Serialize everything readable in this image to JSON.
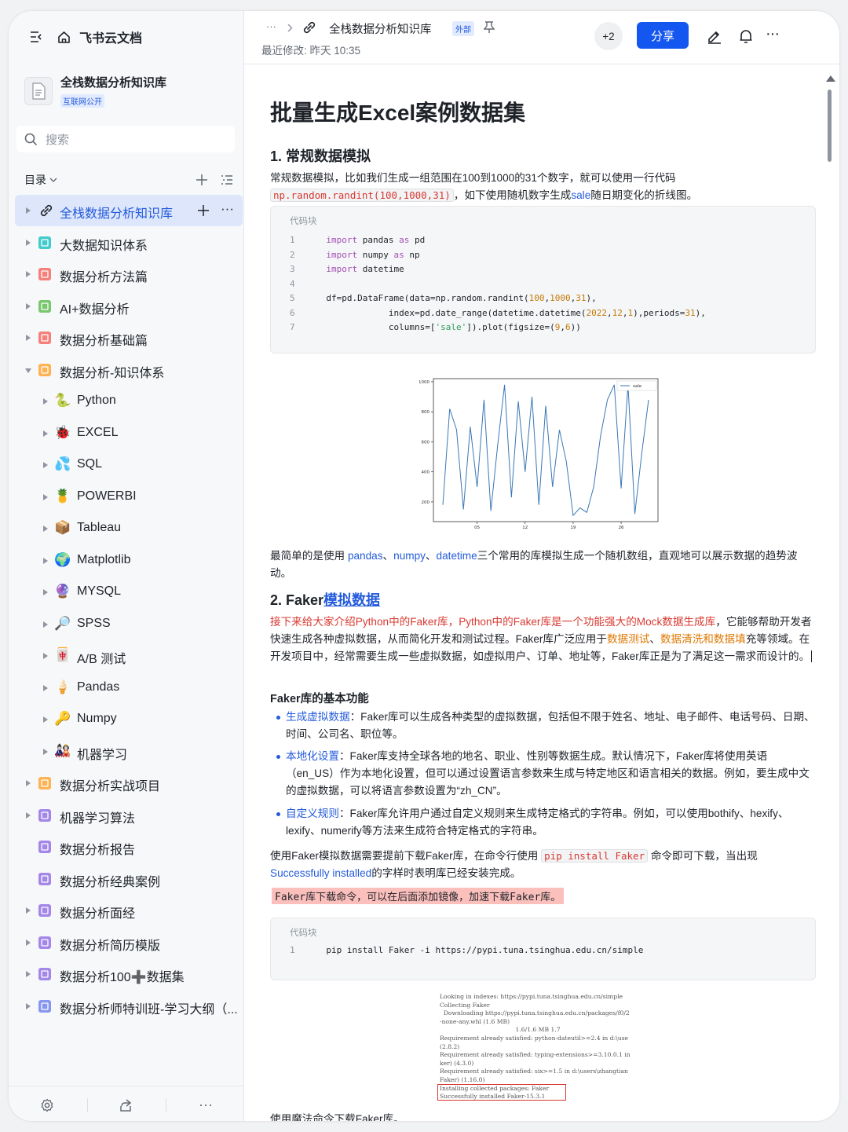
{
  "app": {
    "title": "飞书云文档"
  },
  "space": {
    "name": "全栈数据分析知识库",
    "badge": "互联网公开"
  },
  "search": {
    "placeholder": "搜索"
  },
  "toc": {
    "label": "目录"
  },
  "tree": [
    {
      "label": "全栈数据分析知识库",
      "level": 0,
      "active": true,
      "expand": "right",
      "color": "#245bdb"
    },
    {
      "label": "大数据知识体系",
      "level": 0,
      "expand": "right",
      "color": "#2ec7c9"
    },
    {
      "label": "数据分析方法篇",
      "level": 0,
      "expand": "right",
      "color": "#f5746d"
    },
    {
      "label": "AI+数据分析",
      "level": 0,
      "expand": "right",
      "color": "#6cc25e"
    },
    {
      "label": "数据分析基础篇",
      "level": 0,
      "expand": "right",
      "color": "#f5746d"
    },
    {
      "label": "数据分析-知识体系",
      "level": 0,
      "expand": "down",
      "color": "#ffab40"
    },
    {
      "label": "Python",
      "level": 1,
      "expand": "right",
      "emoji": "🐍"
    },
    {
      "label": "EXCEL",
      "level": 1,
      "expand": "right",
      "emoji": "🐞"
    },
    {
      "label": "SQL",
      "level": 1,
      "expand": "right",
      "emoji": "💦"
    },
    {
      "label": "POWERBI",
      "level": 1,
      "expand": "right",
      "emoji": "🍍"
    },
    {
      "label": "Tableau",
      "level": 1,
      "expand": "right",
      "emoji": "📦"
    },
    {
      "label": "Matplotlib",
      "level": 1,
      "expand": "right",
      "emoji": "🌍"
    },
    {
      "label": "MYSQL",
      "level": 1,
      "expand": "right",
      "emoji": "🔮"
    },
    {
      "label": "SPSS",
      "level": 1,
      "expand": "right",
      "emoji": "🔎"
    },
    {
      "label": "A/B 测试",
      "level": 1,
      "expand": "right",
      "emoji": "🀄"
    },
    {
      "label": "Pandas",
      "level": 1,
      "expand": "right",
      "emoji": "🍦"
    },
    {
      "label": "Numpy",
      "level": 1,
      "expand": "right",
      "emoji": "🔑"
    },
    {
      "label": "机器学习",
      "level": 1,
      "expand": "right",
      "emoji": "🎎"
    },
    {
      "label": "数据分析实战项目",
      "level": 0,
      "expand": "right",
      "color": "#ffab40"
    },
    {
      "label": "机器学习算法",
      "level": 0,
      "expand": "right",
      "color": "#9b7be8"
    },
    {
      "label": "数据分析报告",
      "level": 0,
      "expand": "none",
      "color": "#9b7be8"
    },
    {
      "label": "数据分析经典案例",
      "level": 0,
      "expand": "none",
      "color": "#9b7be8"
    },
    {
      "label": "数据分析面经",
      "level": 0,
      "expand": "right",
      "color": "#9b7be8"
    },
    {
      "label": "数据分析简历模版",
      "level": 0,
      "expand": "right",
      "color": "#9b7be8"
    },
    {
      "label": "数据分析100➕数据集",
      "level": 0,
      "expand": "right",
      "color": "#9b7be8"
    },
    {
      "label": "数据分析师特训班-学习大纲（...",
      "level": 0,
      "expand": "right",
      "color": "#7b8cf0"
    }
  ],
  "topbar": {
    "ellipsis": "···",
    "breadcrumb": "全栈数据分析知识库",
    "external": "外部",
    "modified": "最近修改: 昨天 10:35",
    "collab": "+2",
    "share": "分享"
  },
  "doc": {
    "title": "批量生成Excel案例数据集",
    "h1": "1. 常规数据模拟",
    "p1a": "常规数据模拟，比如我们生成一组范围在100到1000的31个数字，就可以使用一行代码",
    "p1code": "np.random.randint(100,1000,31)",
    "p1b": "，如下使用随机数字生成",
    "p1link": "sale",
    "p1c": "随日期变化的折线图。",
    "code_label": "代码块",
    "code1": [
      "import pandas as pd",
      "import numpy as np",
      "import datetime",
      "",
      "df=pd.DataFrame(data=np.random.randint(100,1000,31),",
      "            index=pd.date_range(datetime.datetime(2022,12,1),periods=31),",
      "            columns=['sale']).plot(figsize=(9,6))"
    ],
    "p2a": "最简单的是使用 ",
    "p2l1": "pandas",
    "p2sep": "、",
    "p2l2": "numpy",
    "p2l3": "datetime",
    "p2b": "三个常用的库模拟生成一个随机数组，直观地可以展示数据的趋势波动。",
    "h2a": "2. Faker",
    "h2b": "模拟数据",
    "p3red": "接下来给大家介绍Python中的Faker库，Python中的Faker库是一个功能强大的Mock数据生成库",
    "p3a": "，它能够帮助开发者快速生成各种虚拟数据，从而简化开发和测试过程。Faker库广泛应用于",
    "p3o1": "数据测试",
    "p3o2": "数据清洗和数据填",
    "p3b": "充等领域。在开发项目中，经常需要生成一些虚拟数据，如虚拟用户、订单、地址等，Faker库正是为了满足这一需求而设计的。",
    "h3": "Faker库的基本功能",
    "bullets": [
      {
        "link": "生成虚拟数据",
        "text": "：Faker库可以生成各种类型的虚拟数据，包括但不限于姓名、地址、电子邮件、电话号码、日期、时间、公司名、职位等。"
      },
      {
        "link": "本地化设置",
        "text": "：Faker库支持全球各地的地名、职业、性别等数据生成。默认情况下，Faker库将使用英语（en_US）作为本地化设置，但可以通过设置语言参数来生成与特定地区和语言相关的数据。例如，要生成中文的虚拟数据，可以将语言参数设置为“zh_CN”。"
      },
      {
        "link": "自定义规则",
        "text": "：Faker库允许用户通过自定义规则来生成特定格式的字符串。例如，可以使用bothify、hexify、lexify、numerify等方法来生成符合特定格式的字符串。"
      }
    ],
    "p4a": "使用Faker模拟数据需要提前下载Faker库，在命令行使用 ",
    "p4code": "pip install Faker",
    "p4b": " 命令即可下载，当出现",
    "p4link": "Successfully installed",
    "p4c": "的字样时表明库已经安装完成。",
    "highlight": "Faker库下载命令，可以在后面添加镜像，加速下载Faker库。",
    "code2": [
      "pip install Faker -i https://pypi.tuna.tsinghua.edu.cn/simple"
    ],
    "terminal": [
      "Looking in indexes: https://pypi.tuna.tsinghua.edu.cn/simple",
      "Collecting Faker",
      "  Downloading https://pypi.tuna.tsinghua.edu.cn/packages/f0/2",
      "-none-any.whl (1.6 MB)",
      "                                        1.6/1.6 MB 1.7",
      "Requirement already satisfied: python-dateutil>=2.4 in d:\\use",
      "(2.8.2)",
      "Requirement already satisfied: typing-extensions>=3.10.0.1 in",
      "ker) (4.3.0)",
      "Requirement already satisfied: six>=1.5 in d:\\users\\zhangtian",
      "Faker) (1.16.0)",
      "Installing collected packages: Faker",
      "Successfully installed Faker-15.3.1"
    ],
    "p5": "使用魔法命令下载Faker库。"
  },
  "chart_data": {
    "type": "line",
    "x": [
      1,
      2,
      3,
      4,
      5,
      6,
      7,
      8,
      9,
      10,
      11,
      12,
      13,
      14,
      15,
      16,
      17,
      18,
      19,
      20,
      21,
      22,
      23,
      24,
      25,
      26,
      27,
      28,
      29,
      30,
      31
    ],
    "series": [
      {
        "name": "sale",
        "values": [
          180,
          820,
          680,
          150,
          700,
          300,
          880,
          140,
          580,
          980,
          230,
          870,
          400,
          900,
          180,
          840,
          300,
          680,
          470,
          110,
          160,
          130,
          300,
          640,
          880,
          980,
          290,
          980,
          120,
          520,
          880
        ]
      }
    ],
    "ylim": [
      100,
      1000
    ],
    "yticks": [
      200,
      400,
      600,
      800,
      1000
    ],
    "xticks": [
      {
        "x": 6,
        "label": "05"
      },
      {
        "x": 13,
        "label": "12"
      },
      {
        "x": 20,
        "label": "19"
      },
      {
        "x": 27,
        "label": "26"
      }
    ],
    "legend": "top-right",
    "color": "#3a77b6"
  }
}
